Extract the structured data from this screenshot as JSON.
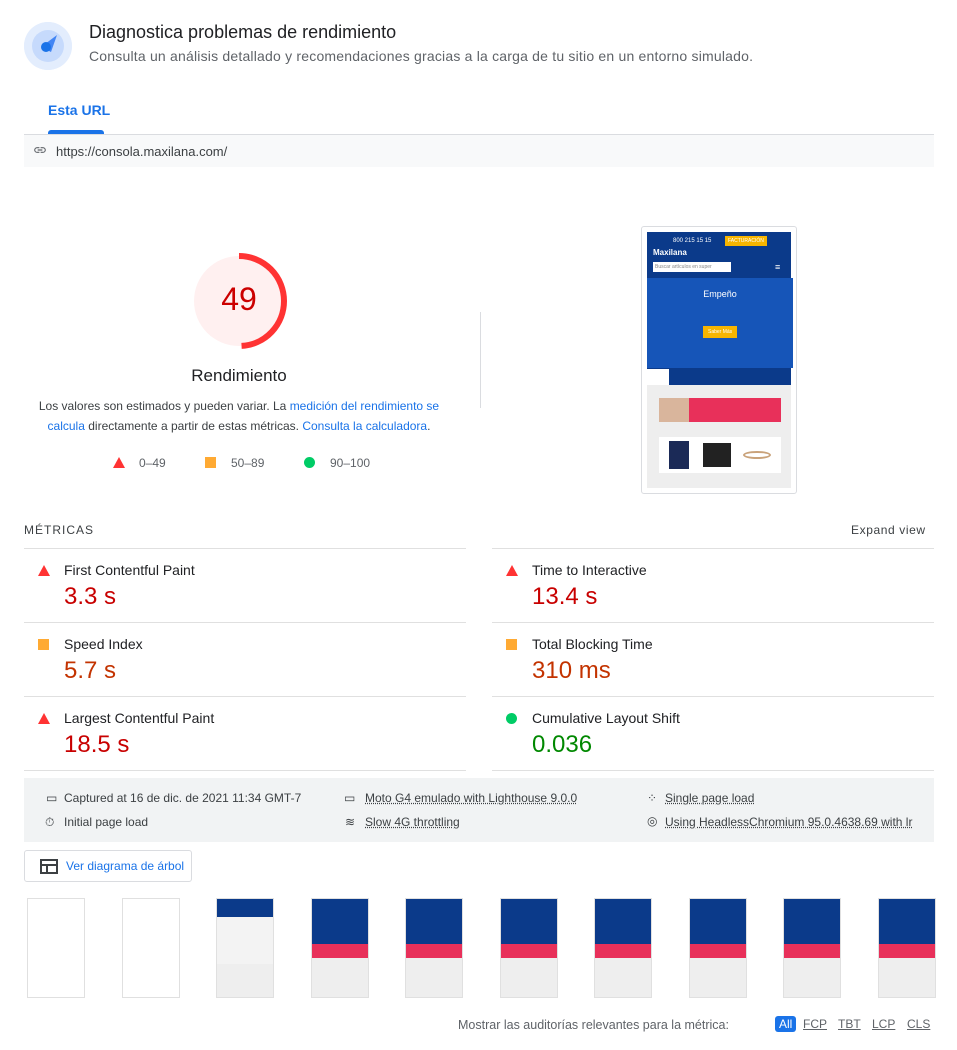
{
  "header": {
    "title": "Diagnostica problemas de rendimiento",
    "subtitle": "Consulta un análisis detallado y recomendaciones gracias a la carga de tu sitio en un entorno simulado.",
    "icon": "gauge-icon"
  },
  "tabs": [
    {
      "label": "Esta URL",
      "active": true
    }
  ],
  "url": "https://consola.maxilana.com/",
  "score": {
    "value": 49,
    "label": "Rendimiento",
    "color": "#ff3333"
  },
  "description": {
    "text1": "Los valores son estimados y pueden variar. La ",
    "link1": "medición del rendimiento se calcula",
    "text2": " directamente a partir de estas métricas. ",
    "link2": "Consulta la calculadora",
    "text3": "."
  },
  "legend": [
    {
      "shape": "triangle",
      "range": "0–49",
      "color": "#ff3333"
    },
    {
      "shape": "square",
      "range": "50–89",
      "color": "#ffaa33"
    },
    {
      "shape": "circle",
      "range": "90–100",
      "color": "#00cc66"
    }
  ],
  "metrics_header": "MÉTRICAS",
  "expand_view": "Expand view",
  "metrics": [
    {
      "label": "First Contentful Paint",
      "value": "3.3 s",
      "rating": "triangle",
      "color": "#c80000"
    },
    {
      "label": "Time to Interactive",
      "value": "13.4 s",
      "rating": "triangle",
      "color": "#c80000"
    },
    {
      "label": "Speed Index",
      "value": "5.7 s",
      "rating": "square",
      "color": "#c33300"
    },
    {
      "label": "Total Blocking Time",
      "value": "310 ms",
      "rating": "square",
      "color": "#c33300"
    },
    {
      "label": "Largest Contentful Paint",
      "value": "18.5 s",
      "rating": "triangle",
      "color": "#c80000"
    },
    {
      "label": "Cumulative Layout Shift",
      "value": "0.036",
      "rating": "circle",
      "color": "#008800"
    }
  ],
  "env": {
    "captured": "Captured at 16 de dic. de 2021 11:34 GMT-7",
    "device": "Moto G4 emulado with Lighthouse 9.0.0",
    "session": "Single page load",
    "load": "Initial page load",
    "throttling": "Slow 4G throttling",
    "browser": "Using HeadlessChromium 95.0.4638.69 with lr"
  },
  "treemap_button": "Ver diagrama de árbol",
  "screenshot": {
    "phone": "800 215 15 15",
    "cta": "FACTURACIÓN",
    "brand": "Maxilana",
    "search_placeholder": "Buscar artículos en super",
    "hero_title": "Empeño",
    "hero_button": "Saber Más"
  },
  "filmstrip": [
    "blank",
    "blank",
    "partial",
    "full",
    "full",
    "full",
    "full",
    "full",
    "full",
    "full"
  ],
  "footer": {
    "label": "Mostrar las auditorías relevantes para la métrica:",
    "filters": [
      "All",
      "FCP",
      "TBT",
      "LCP",
      "CLS"
    ],
    "active": "All"
  }
}
